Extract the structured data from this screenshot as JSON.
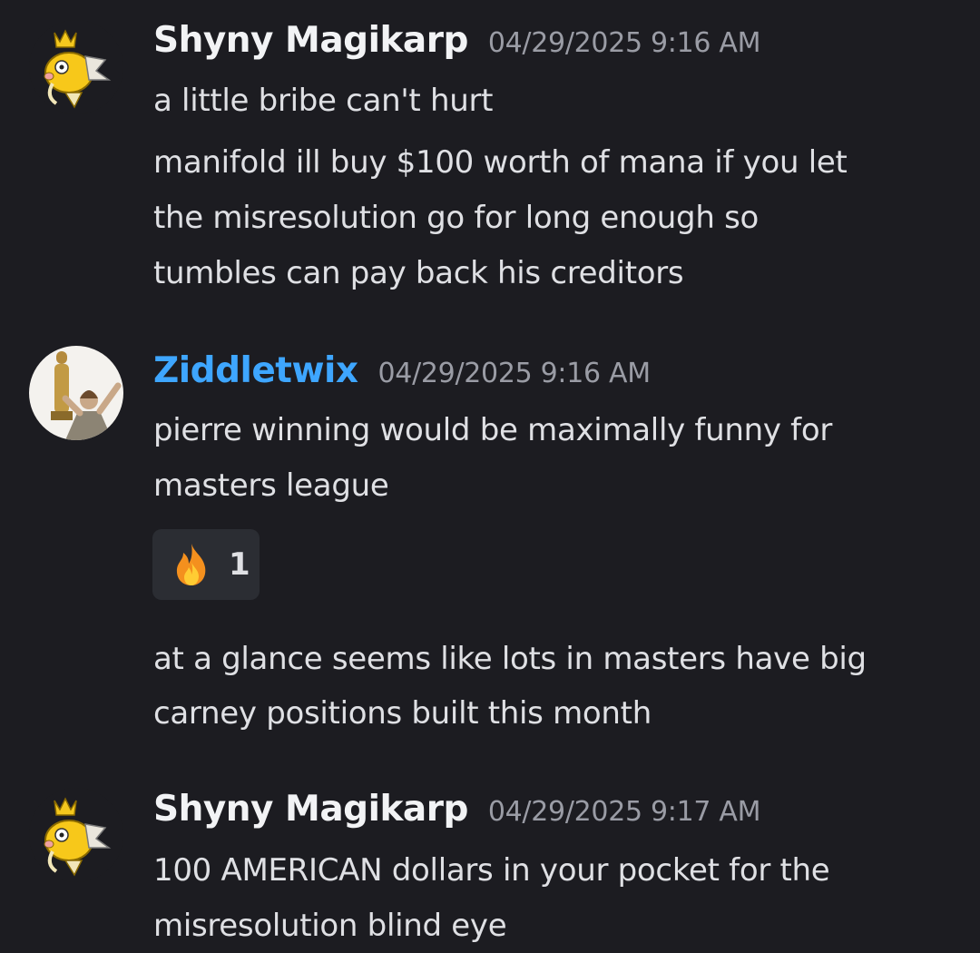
{
  "messages": [
    {
      "author": "Shyny Magikarp",
      "timestamp": "04/29/2025 9:16 AM",
      "avatar": "magikarp-avatar",
      "lines": [
        "a little bribe can't hurt"
      ],
      "followups": [
        [
          "manifold ill buy $100 worth of mana if you let",
          "the misresolution go for long enough so",
          "tumbles can pay back his creditors"
        ]
      ]
    },
    {
      "author": "Ziddletwix",
      "timestamp": "04/29/2025 9:16 AM",
      "author_color": "#3ea6ff",
      "avatar": "oscar-statue-avatar",
      "lines": [
        "pierre winning would be maximally funny for",
        "masters league"
      ],
      "reaction": {
        "emoji": "fire-emoji",
        "count": "1"
      },
      "followups": [
        [
          "at a glance seems like lots in masters have big",
          "carney positions built this month"
        ]
      ]
    },
    {
      "author": "Shyny Magikarp",
      "timestamp": "04/29/2025 9:17 AM",
      "avatar": "magikarp-avatar",
      "lines": [
        "100 AMERICAN dollars in your pocket for the",
        "misresolution blind eye"
      ]
    }
  ],
  "colors": {
    "background": "#1c1c21",
    "text": "#dfe0e4",
    "timestamp": "#9a9ca5",
    "reaction_bg": "#2b2d33"
  }
}
